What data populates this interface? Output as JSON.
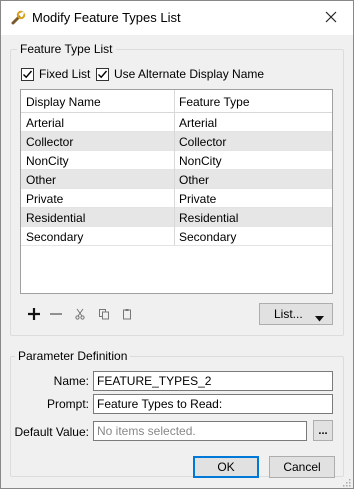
{
  "window": {
    "title": "Modify Feature Types List",
    "icon": "wrench-icon",
    "close_glyph": "✕"
  },
  "feature_type_list": {
    "group_label": "Feature Type List",
    "fixed_list": {
      "label": "Fixed List",
      "checked": true
    },
    "alt_display": {
      "label": "Use Alternate Display Name",
      "checked": true
    },
    "columns": [
      "Display Name",
      "Feature Type"
    ],
    "rows": [
      {
        "display": "Arterial",
        "type": "Arterial"
      },
      {
        "display": "Collector",
        "type": "Collector"
      },
      {
        "display": "NonCity",
        "type": "NonCity"
      },
      {
        "display": "Other",
        "type": "Other"
      },
      {
        "display": "Private",
        "type": "Private"
      },
      {
        "display": "Residential",
        "type": "Residential"
      },
      {
        "display": "Secondary",
        "type": "Secondary"
      }
    ],
    "toolbar": {
      "add_icon": "plus-icon",
      "remove_icon": "minus-icon",
      "cut_icon": "scissors-icon",
      "copy_icon": "copy-icon",
      "paste_icon": "paste-icon",
      "list_label": "List..."
    }
  },
  "parameter_definition": {
    "group_label": "Parameter Definition",
    "name_label": "Name:",
    "name_value": "FEATURE_TYPES_2",
    "prompt_label": "Prompt:",
    "prompt_value": "Feature Types to Read:",
    "default_label": "Default Value:",
    "default_placeholder": "No items selected.",
    "browse_label": "..."
  },
  "buttons": {
    "ok": "OK",
    "cancel": "Cancel"
  },
  "colors": {
    "accent": "#0078d7",
    "alt_row": "#e6e6e6"
  }
}
